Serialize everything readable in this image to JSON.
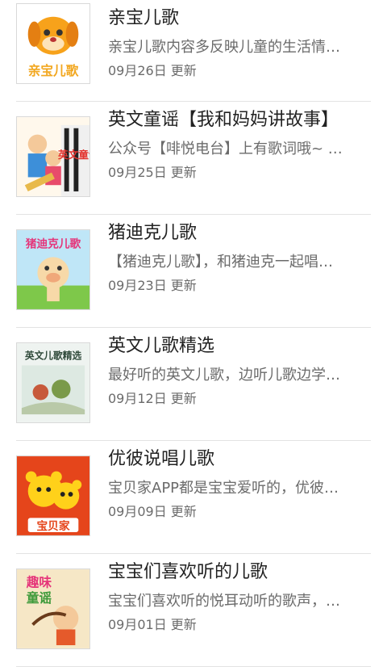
{
  "items": [
    {
      "title": "亲宝儿歌",
      "desc": "亲宝儿歌内容多反映儿童的生活情…",
      "date": "09月26日 更新",
      "thumb_text": "亲宝儿歌",
      "thumb_icon": "cartoon-dog-icon"
    },
    {
      "title": "英文童谣【我和妈妈讲故事】",
      "desc": "公众号【啡悦电台】上有歌词哦~ …",
      "date": "09月25日 更新",
      "thumb_text": "英文童谣",
      "thumb_icon": "music-kids-icon"
    },
    {
      "title": "猪迪克儿歌",
      "desc": "【猪迪克儿歌】，和猪迪克一起唱…",
      "date": "09月23日 更新",
      "thumb_text": "猪迪克儿歌",
      "thumb_icon": "cartoon-pig-icon"
    },
    {
      "title": "英文儿歌精选",
      "desc": "最好听的英文儿歌，边听儿歌边学…",
      "date": "09月12日 更新",
      "thumb_text": "英文儿歌精选",
      "thumb_icon": "storybook-illustration-icon"
    },
    {
      "title": "优彼说唱儿歌",
      "desc": "宝贝家APP都是宝宝爱听的，优彼…",
      "date": "09月09日 更新",
      "thumb_text": "宝贝家",
      "thumb_icon": "cartoon-bears-icon"
    },
    {
      "title": "宝宝们喜欢听的儿歌",
      "desc": "宝宝们喜欢听的悦耳动听的歌声，…",
      "date": "09月01日 更新",
      "thumb_text": "趣味童谣",
      "thumb_icon": "cartoon-kid-icon"
    }
  ]
}
